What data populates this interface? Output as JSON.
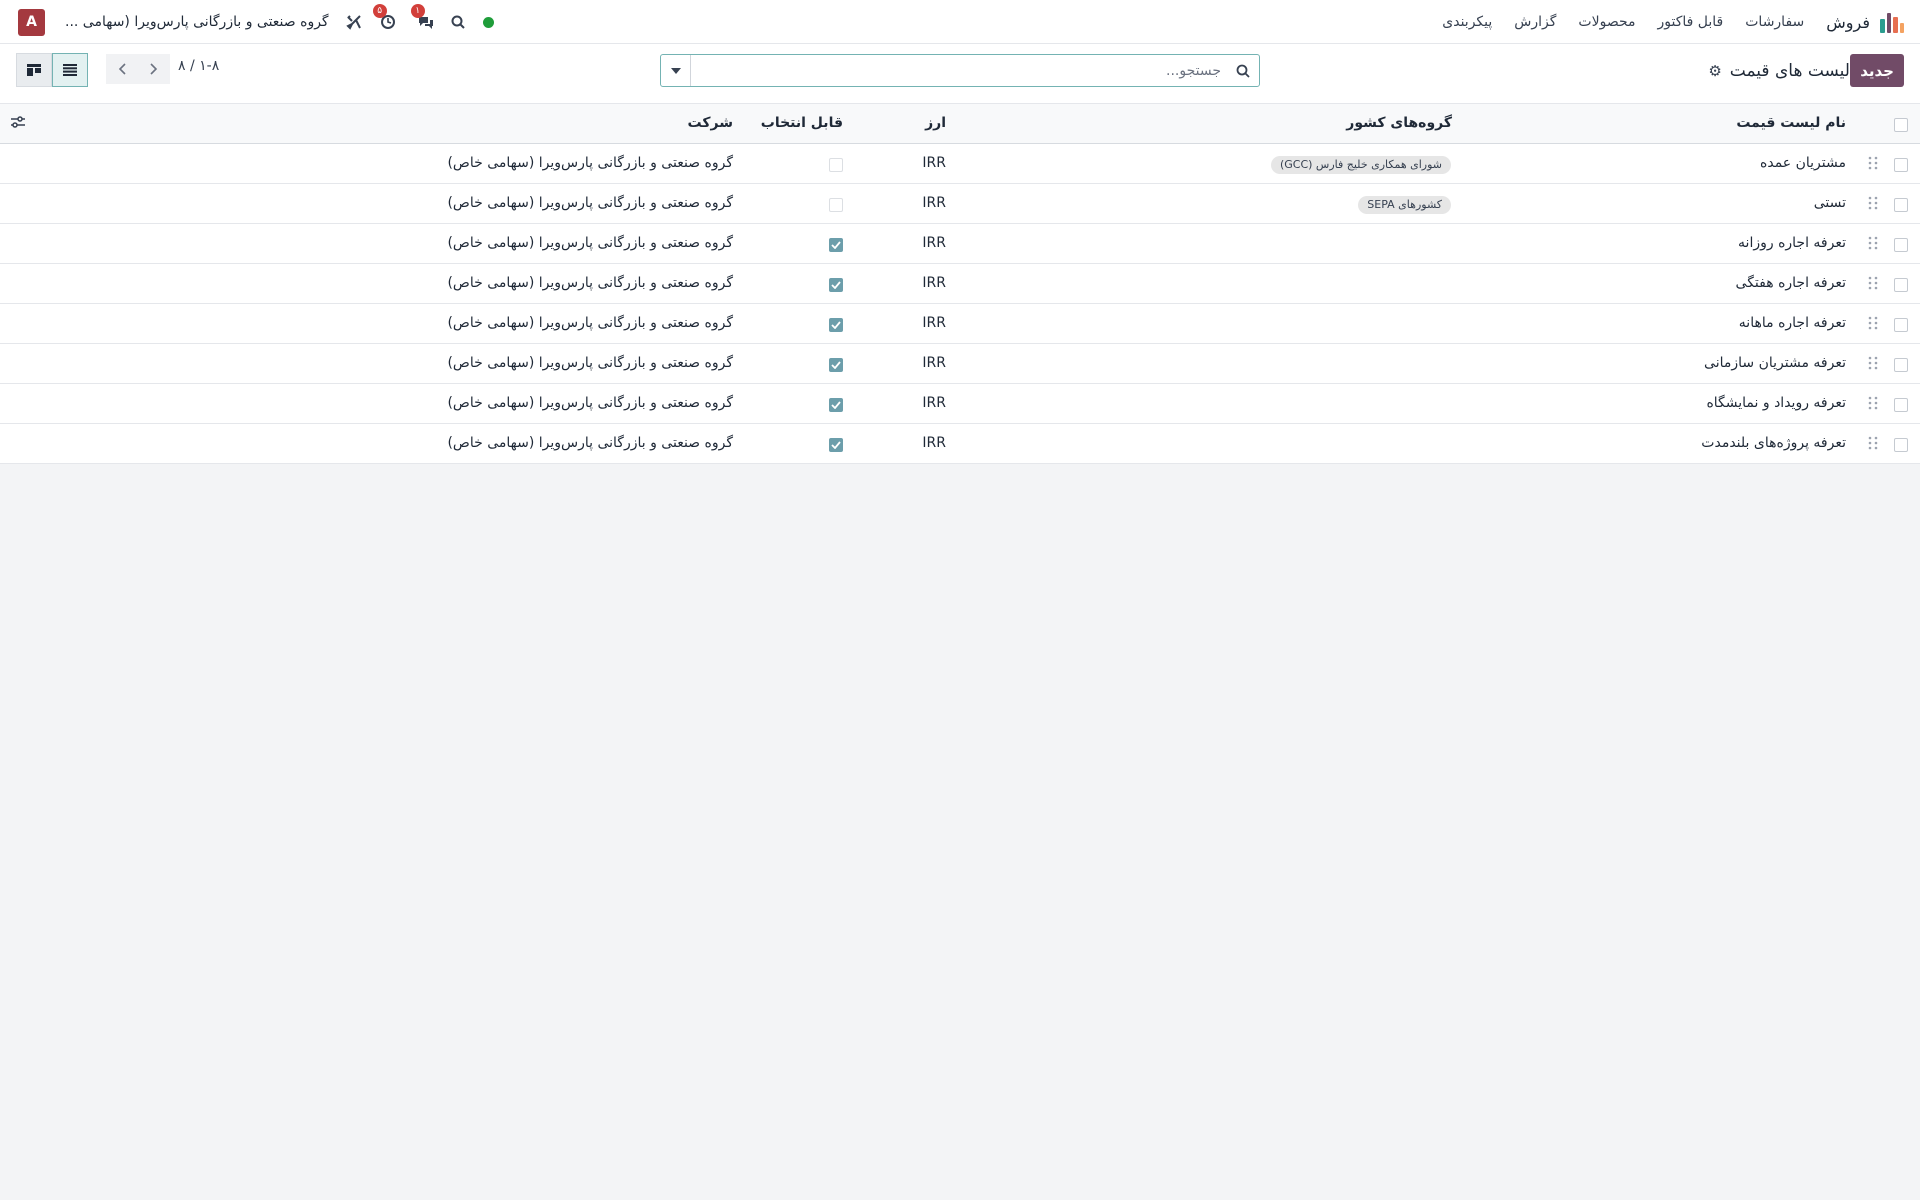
{
  "navbar": {
    "app_title": "فروش",
    "menu": [
      "سفارشات",
      "قابل فاکتور",
      "محصولات",
      "گزارش",
      "پیکربندی"
    ],
    "company": "گروه صنعتی و بازرگانی پارس‌ویرا (سهامی ...",
    "avatar_letter": "A",
    "activity_badge": "۵",
    "messages_badge": "۱",
    "logo_colors": [
      "#f4a261",
      "#e76f51",
      "#2a9d8f",
      "#714b67"
    ]
  },
  "control_panel": {
    "new_button": "جدید",
    "page_title": "لیست های قیمت",
    "search_placeholder": "جستجو...",
    "pager": "۱-۸ / ۸"
  },
  "table": {
    "headers": {
      "name": "نام لیست قیمت",
      "country_groups": "گروه‌های کشور",
      "currency": "ارز",
      "selectable": "قابل انتخاب",
      "company": "شرکت"
    },
    "rows": [
      {
        "name": "مشتریان عمده",
        "country_group": "شورای همکاری خلیج فارس (GCC)",
        "currency": "IRR",
        "selectable": false,
        "company": "گروه صنعتی و بازرگانی پارس‌ویرا (سهامی خاص)"
      },
      {
        "name": "تستی",
        "country_group": "کشورهای SEPA",
        "currency": "IRR",
        "selectable": false,
        "company": "گروه صنعتی و بازرگانی پارس‌ویرا (سهامی خاص)"
      },
      {
        "name": "تعرفه اجاره روزانه",
        "country_group": "",
        "currency": "IRR",
        "selectable": true,
        "company": "گروه صنعتی و بازرگانی پارس‌ویرا (سهامی خاص)"
      },
      {
        "name": "تعرفه اجاره هفتگی",
        "country_group": "",
        "currency": "IRR",
        "selectable": true,
        "company": "گروه صنعتی و بازرگانی پارس‌ویرا (سهامی خاص)"
      },
      {
        "name": "تعرفه اجاره ماهانه",
        "country_group": "",
        "currency": "IRR",
        "selectable": true,
        "company": "گروه صنعتی و بازرگانی پارس‌ویرا (سهامی خاص)"
      },
      {
        "name": "تعرفه مشتریان سازمانی",
        "country_group": "",
        "currency": "IRR",
        "selectable": true,
        "company": "گروه صنعتی و بازرگانی پارس‌ویرا (سهامی خاص)"
      },
      {
        "name": "تعرفه رویداد و نمایشگاه",
        "country_group": "",
        "currency": "IRR",
        "selectable": true,
        "company": "گروه صنعتی و بازرگانی پارس‌ویرا (سهامی خاص)"
      },
      {
        "name": "تعرفه پروژه‌های بلندمدت",
        "country_group": "",
        "currency": "IRR",
        "selectable": true,
        "company": "گروه صنعتی و بازرگانی پارس‌ویرا (سهامی خاص)"
      }
    ]
  }
}
